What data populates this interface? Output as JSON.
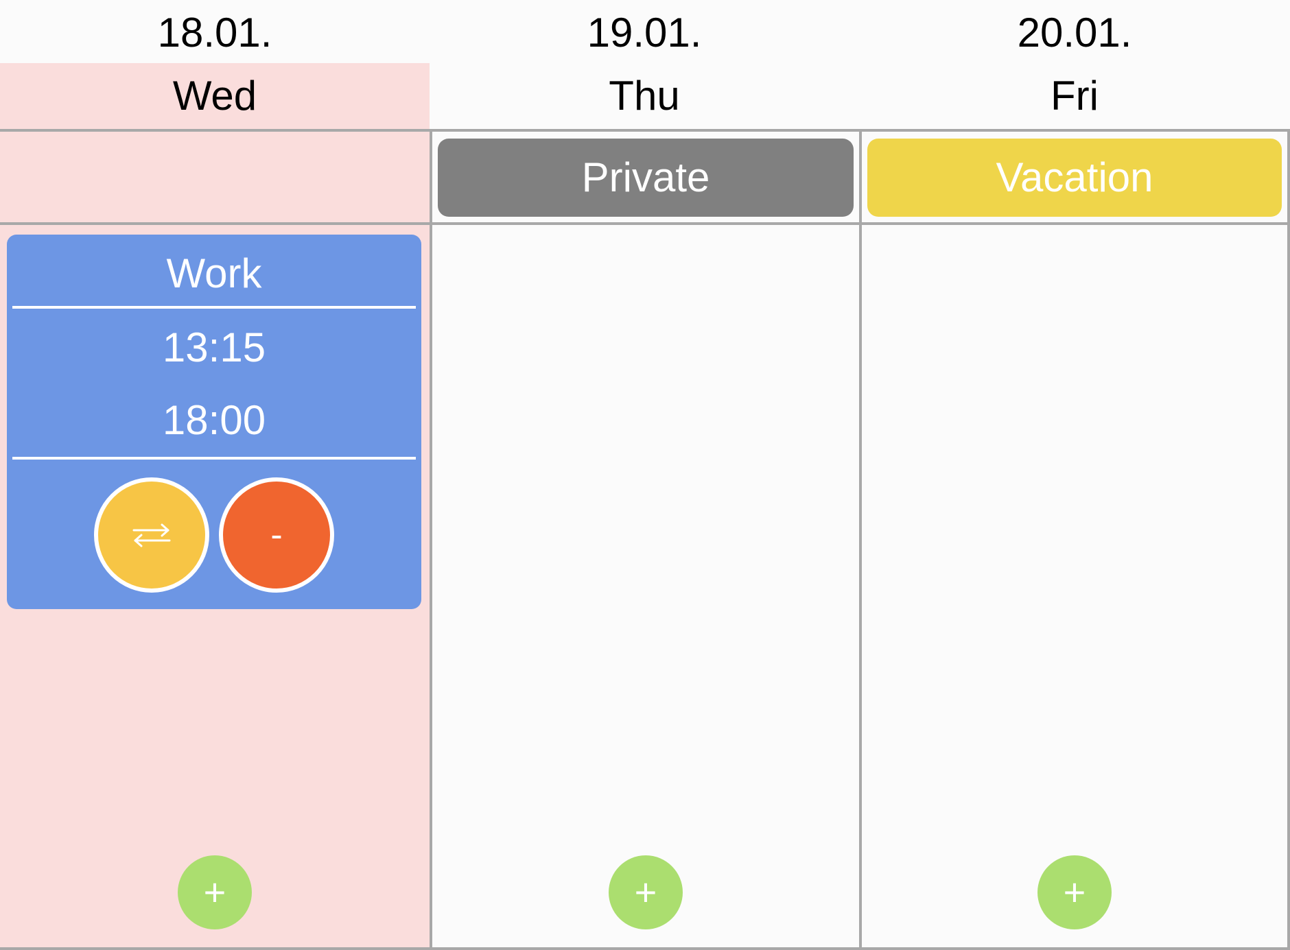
{
  "days": [
    {
      "date": "18.01.",
      "weekday": "Wed",
      "add_label": "+"
    },
    {
      "date": "19.01.",
      "weekday": "Thu",
      "add_label": "+"
    },
    {
      "date": "20.01.",
      "weekday": "Fri",
      "add_label": "+"
    }
  ],
  "allday_events": {
    "thu": {
      "label": "Private",
      "color": "#808080"
    },
    "fri": {
      "label": "Vacation",
      "color": "#efd54a"
    }
  },
  "event": {
    "title": "Work",
    "start": "13:15",
    "end": "18:00",
    "color": "#6d96e4",
    "swap_icon": "swap-arrows-icon",
    "swap_color": "#f7c545",
    "remove_label": "-",
    "remove_color": "#f0652f"
  },
  "colors": {
    "today_highlight": "#fadddc",
    "add_button": "#abde6f",
    "grid_line": "#a8a8a8"
  }
}
